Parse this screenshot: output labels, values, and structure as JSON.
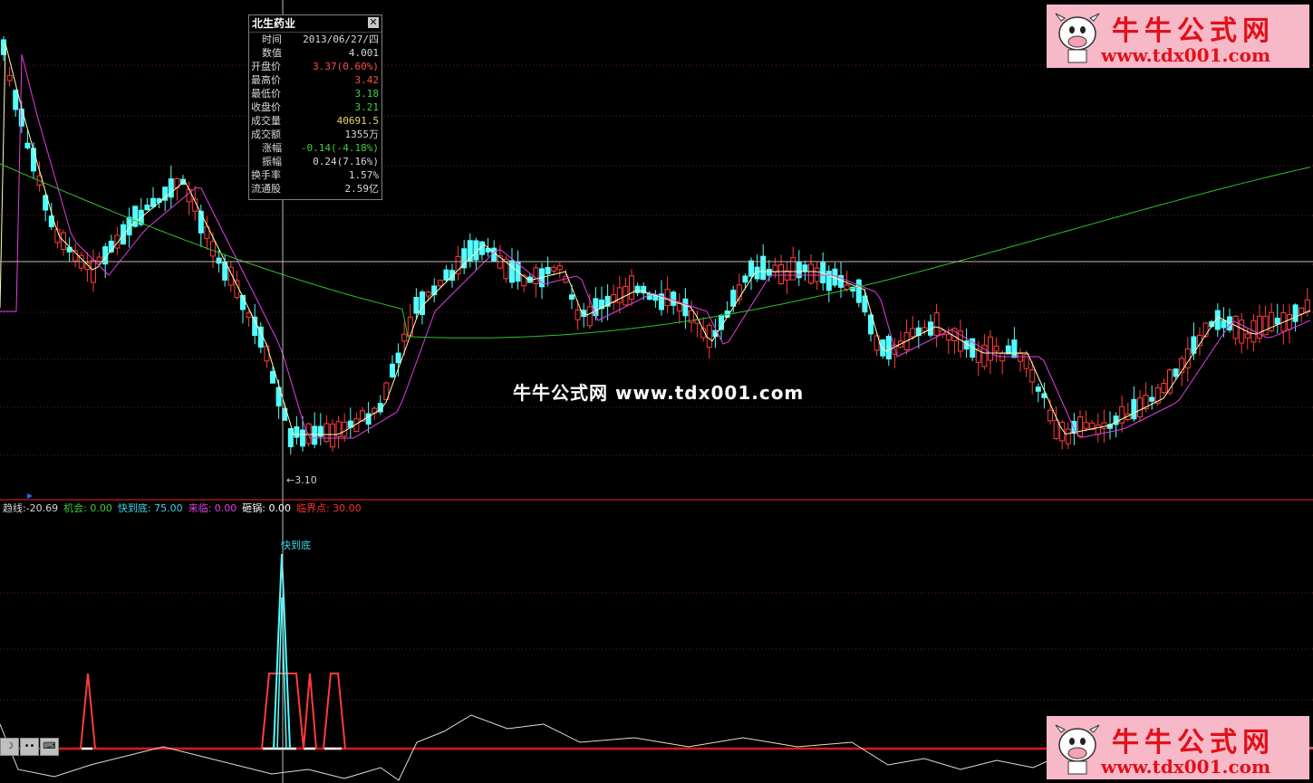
{
  "info_panel": {
    "title": "北生药业",
    "rows": [
      {
        "label": "时间",
        "value": "2013/06/27/四",
        "indent": true,
        "color": "#d8d8d8"
      },
      {
        "label": "数值",
        "value": "4.001",
        "indent": true,
        "color": "#d8d8d8"
      },
      {
        "label": "开盘价",
        "value": "3.37(0.60%)",
        "indent": false,
        "color": "#ff4d4d"
      },
      {
        "label": "最高价",
        "value": "3.42",
        "indent": false,
        "color": "#ff4d4d"
      },
      {
        "label": "最低价",
        "value": "3.18",
        "indent": false,
        "color": "#3cd23c"
      },
      {
        "label": "收盘价",
        "value": "3.21",
        "indent": false,
        "color": "#3cd23c"
      },
      {
        "label": "成交量",
        "value": "40691.5",
        "indent": false,
        "color": "#e6d46a"
      },
      {
        "label": "成交额",
        "value": "1355万",
        "indent": false,
        "color": "#d8d8d8"
      },
      {
        "label": "涨幅",
        "value": "-0.14(-4.18%)",
        "indent": true,
        "color": "#3cd23c"
      },
      {
        "label": "振幅",
        "value": "0.24(7.16%)",
        "indent": true,
        "color": "#d8d8d8"
      },
      {
        "label": "换手率",
        "value": "1.57%",
        "indent": false,
        "color": "#d8d8d8"
      },
      {
        "label": "流通股",
        "value": "2.59亿",
        "indent": false,
        "color": "#d8d8d8"
      }
    ]
  },
  "indicator_bar": {
    "items": [
      {
        "text": "趋线:-20.69",
        "color": "#d8d8d8"
      },
      {
        "text": "机会: 0.00",
        "color": "#3cd23c"
      },
      {
        "text": "快到底: 75.00",
        "color": "#3dd6e6"
      },
      {
        "text": "来临: 0.00",
        "color": "#e040e0"
      },
      {
        "text": "砸锅: 0.00",
        "color": "#ffffff"
      },
      {
        "text": "临界点: 30.00",
        "color": "#ff3030"
      }
    ]
  },
  "price_tag": "←3.10",
  "sub_label": "快到底",
  "watermark": "牛牛公式网 www.tdx001.com",
  "logo": {
    "cn": "牛牛公式网",
    "url": "www.tdx001.com"
  },
  "toolbar": {
    "btn_moon": "☽",
    "btn_dots": "••",
    "btn_keyboard": "⌨"
  },
  "colors": {
    "up": "#ff3c3c",
    "down": "#54ffff",
    "ma5": "#ffffb4",
    "ma10": "#e040e0",
    "ma60": "#30c030"
  }
}
